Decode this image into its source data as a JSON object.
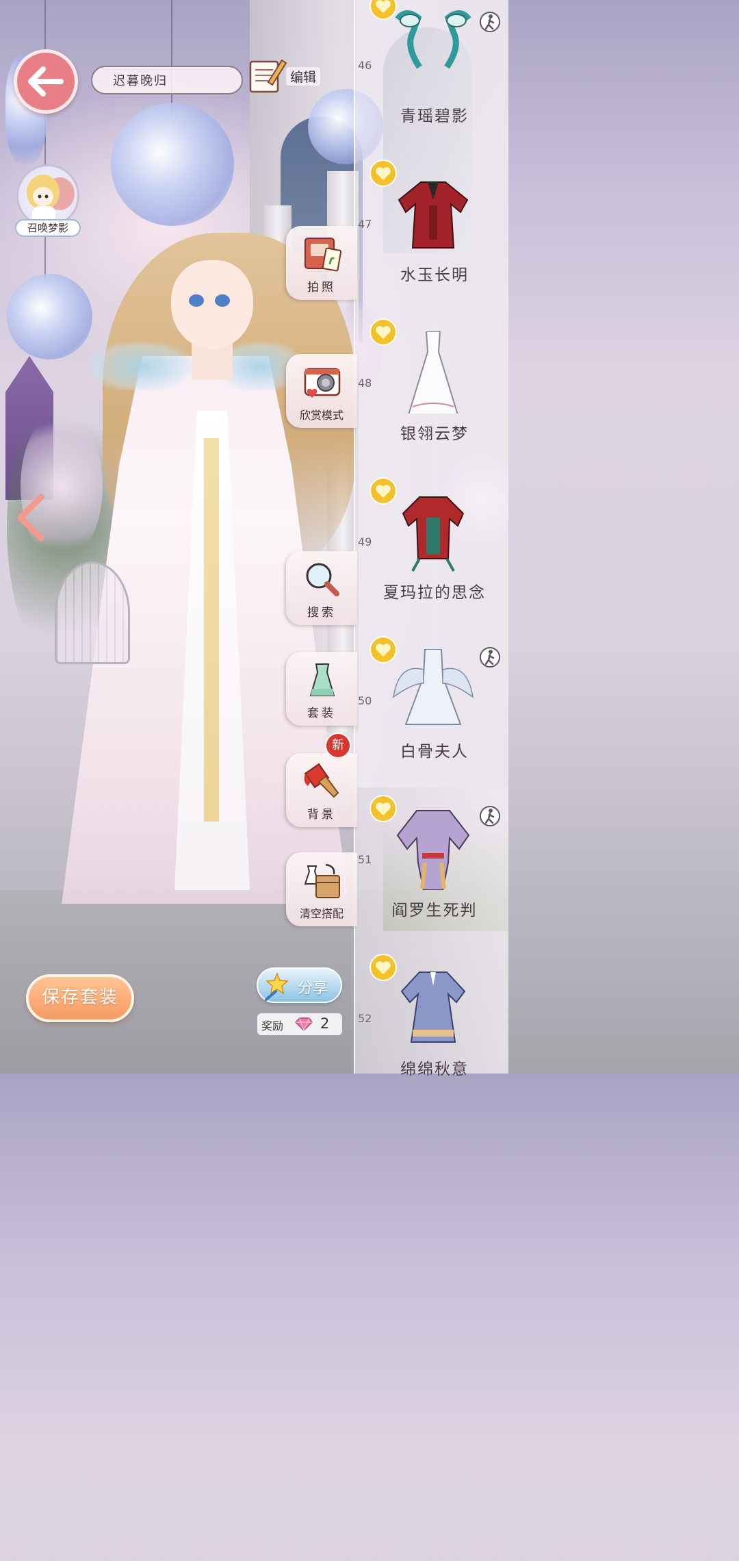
{
  "header": {
    "outfit_name": "迟暮晚归",
    "edit_label": "编辑"
  },
  "summon": {
    "label": "召唤梦影"
  },
  "side_buttons": [
    {
      "label": "拍照",
      "icon": "photo-album-icon"
    },
    {
      "label": "欣赏模式",
      "icon": "camera-icon"
    },
    {
      "label": "搜索",
      "icon": "magnifier-icon"
    },
    {
      "label": "套装",
      "icon": "outfit-icon"
    },
    {
      "label": "背景",
      "icon": "paintbrush-icon"
    },
    {
      "label": "清空搭配",
      "icon": "clear-outfit-icon"
    }
  ],
  "new_badge": "新",
  "items": [
    {
      "number": "46",
      "name": "青瑶碧影",
      "has_motion": true
    },
    {
      "number": "47",
      "name": "水玉长明",
      "has_motion": false
    },
    {
      "number": "48",
      "name": "银翎云梦",
      "has_motion": false
    },
    {
      "number": "49",
      "name": "夏玛拉的思念",
      "has_motion": false
    },
    {
      "number": "50",
      "name": "白骨夫人",
      "has_motion": true
    },
    {
      "number": "51",
      "name": "阎罗生死判",
      "has_motion": true
    },
    {
      "number": "52",
      "name": "绵绵秋意",
      "has_motion": false
    }
  ],
  "bottom": {
    "save_label": "保存套装",
    "share_label": "分享",
    "reward_label": "奖励",
    "reward_count": "2"
  },
  "colors": {
    "back_button": "#e97f86",
    "save_button": "#f79a63",
    "share_button": "#8cc4e4",
    "heart_gold": "#f5c12b",
    "new_badge": "#d9362f"
  }
}
